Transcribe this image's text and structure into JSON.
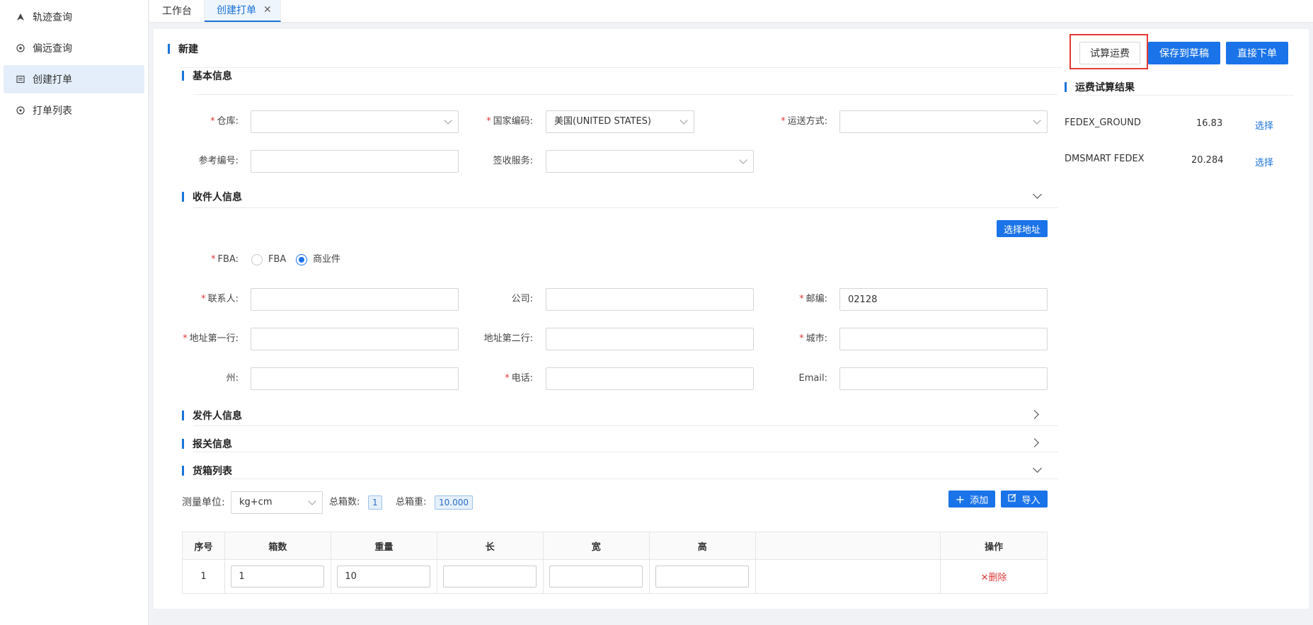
{
  "sidebar": {
    "items": [
      {
        "label": "轨迹查询",
        "icon": "navigation-arrow-icon"
      },
      {
        "label": "偏远查询",
        "icon": "target-icon"
      },
      {
        "label": "创建打单",
        "icon": "form-icon"
      },
      {
        "label": "打单列表",
        "icon": "list-circle-icon"
      }
    ]
  },
  "tabs": [
    {
      "label": "工作台"
    },
    {
      "label": "创建打单"
    }
  ],
  "header": {
    "title": "新建",
    "btn_quote": "试算运费",
    "btn_save": "保存到草稿",
    "btn_submit": "直接下单"
  },
  "basic": {
    "title": "基本信息",
    "warehouse_label": "仓库",
    "warehouse_value": "",
    "country_label": "国家编码",
    "country_value": "美国(UNITED STATES)",
    "shipping_label": "运送方式",
    "shipping_value": "",
    "ref_label": "参考编号",
    "ref_value": "",
    "sign_label": "签收服务",
    "sign_value": ""
  },
  "recipient": {
    "title": "收件人信息",
    "choose_address": "选择地址",
    "fba_label": "FBA",
    "fba_option1": "FBA",
    "fba_option2": "商业件",
    "contact_label": "联系人",
    "contact_value": "",
    "company_label": "公司",
    "company_value": "",
    "zip_label": "邮编",
    "zip_value": "02128",
    "addr1_label": "地址第一行",
    "addr1_value": "",
    "addr2_label": "地址第二行",
    "addr2_value": "",
    "city_label": "城市",
    "city_value": "",
    "state_label": "州",
    "state_value": "",
    "phone_label": "电话",
    "phone_value": "",
    "email_label": "Email",
    "email_value": ""
  },
  "sender": {
    "title": "发件人信息"
  },
  "customs": {
    "title": "报关信息"
  },
  "cartons": {
    "title": "货箱列表",
    "unit_label": "测量单位",
    "unit_value": "kg+cm",
    "total_count_label": "总箱数",
    "total_count_value": "1",
    "total_weight_label": "总箱重",
    "total_weight_value": "10.000",
    "btn_add": "添加",
    "btn_import": "导入",
    "columns": [
      "序号",
      "箱数",
      "重量",
      "长",
      "宽",
      "高",
      "",
      "操作"
    ],
    "rows": [
      {
        "index": "1",
        "count": "1",
        "weight": "10",
        "length": "",
        "width": "",
        "height": "",
        "action": "✕删除"
      }
    ]
  },
  "quote_results": {
    "title": "运费试算结果",
    "items": [
      {
        "name": "FEDEX_GROUND",
        "price": "16.83",
        "action": "选择"
      },
      {
        "name": "DMSMART FEDEX",
        "price": "20.284",
        "action": "选择"
      }
    ]
  }
}
